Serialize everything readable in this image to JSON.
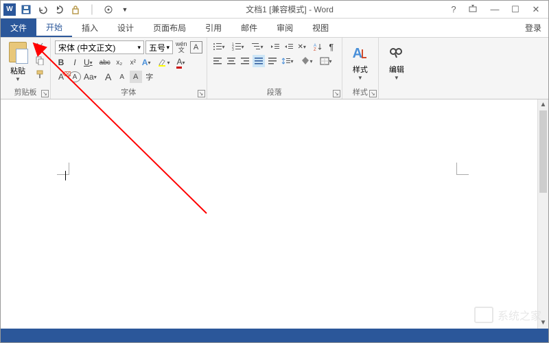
{
  "title": "文档1 [兼容模式] - Word",
  "tabs": {
    "file": "文件",
    "home": "开始",
    "insert": "插入",
    "design": "设计",
    "layout": "页面布局",
    "references": "引用",
    "mailings": "邮件",
    "review": "审阅",
    "view": "视图"
  },
  "login": "登录",
  "clipboard": {
    "paste": "粘贴",
    "group": "剪贴板"
  },
  "font": {
    "name": "宋体 (中文正文)",
    "size": "五号",
    "group": "字体",
    "pinyin": "wén",
    "bold": "B",
    "italic": "I",
    "underline": "U",
    "strike": "abc",
    "sub": "x₂",
    "sup": "x²",
    "bigA": "A",
    "smallA": "A",
    "clear": "A",
    "aa": "Aa",
    "growA": "A",
    "shrinkA": "A"
  },
  "paragraph": {
    "group": "段落"
  },
  "styles": {
    "label": "样式",
    "group": "样式"
  },
  "editing": {
    "label": "编辑"
  },
  "watermark": "系统之家",
  "center_wm": ""
}
